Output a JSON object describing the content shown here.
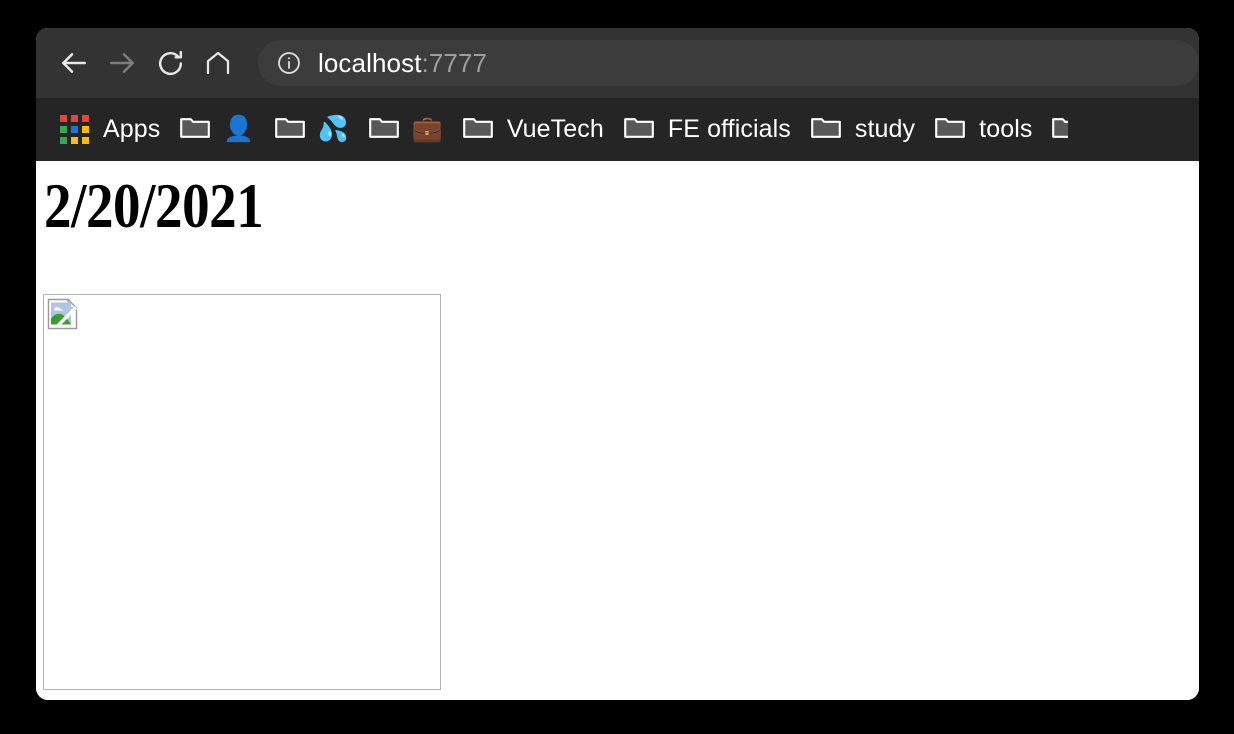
{
  "browser": {
    "toolbar": {
      "back_label": "Back",
      "forward_label": "Forward",
      "reload_label": "Reload",
      "home_label": "Home",
      "omnibox": {
        "site_info_label": "View site information",
        "url_host": "localhost",
        "url_port": ":7777",
        "full_url": "localhost:7777"
      }
    },
    "bookmarks_bar": {
      "apps_label": "Apps",
      "items": [
        {
          "label": "",
          "icon": "folder-icon",
          "emoji": "👤",
          "emoji_name": "bust-in-silhouette-emoji"
        },
        {
          "label": "",
          "icon": "folder-icon",
          "emoji": "💦",
          "emoji_name": "sweat-droplets-emoji"
        },
        {
          "label": "",
          "icon": "folder-icon",
          "emoji": "💼",
          "emoji_name": "briefcase-emoji"
        },
        {
          "label": "VueTech",
          "icon": "folder-icon",
          "emoji": "",
          "emoji_name": ""
        },
        {
          "label": "FE officials",
          "icon": "folder-icon",
          "emoji": "",
          "emoji_name": ""
        },
        {
          "label": "study",
          "icon": "folder-icon",
          "emoji": "",
          "emoji_name": ""
        },
        {
          "label": "tools",
          "icon": "folder-icon",
          "emoji": "",
          "emoji_name": ""
        }
      ],
      "overflow_item": {
        "label": "",
        "icon": "folder-icon"
      }
    }
  },
  "page": {
    "title": "2/20/2021",
    "broken_image": {
      "alt": "",
      "state": "broken"
    }
  },
  "colors": {
    "toolbar_bg": "#333333",
    "bookmarks_bg": "#252525",
    "omnibox_bg": "#3c3c3c",
    "page_bg": "#ffffff",
    "text_primary": "#ffffff",
    "text_muted": "#9e9e9e",
    "desktop_bg": "#000000",
    "apps_red": "#ea4335",
    "apps_blue": "#1a73e8",
    "apps_green": "#34a853",
    "apps_orange": "#fbbc04",
    "image_border": "#b3b3b3",
    "broken_sky": "#aec5e8",
    "broken_hill": "#3a9e2e"
  }
}
